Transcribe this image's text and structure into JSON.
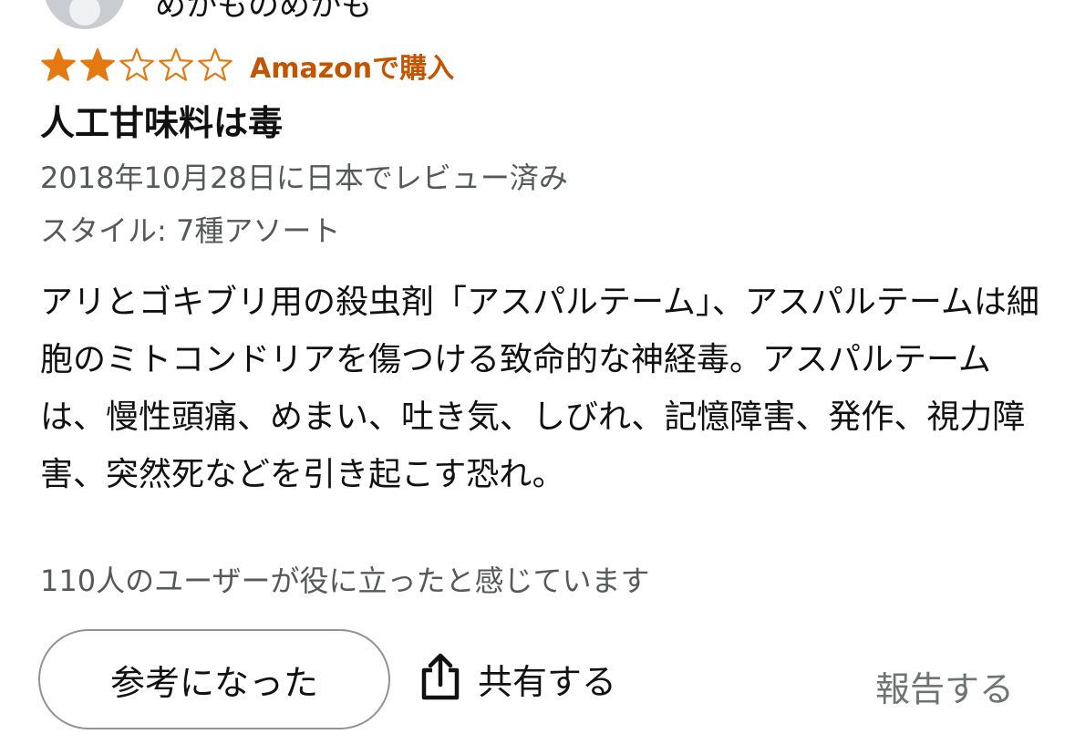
{
  "review": {
    "reviewer_name": "めかものめかも",
    "rating": 2,
    "rating_max": 5,
    "star_color": "#e47911",
    "verified_label": "Amazonで購入",
    "title": "人工甘味料は毒",
    "date_line": "2018年10月28日に日本でレビュー済み",
    "style_line": "スタイル: 7種アソート",
    "body": "アリとゴキブリ用の殺虫剤「アスパルテーム」、アスパルテームは細胞のミトコンドリアを傷つける致命的な神経毒。アスパルテームは、慢性頭痛、めまい、吐き気、しびれ、記憶障害、発作、視力障害、突然死などを引き起こす恐れ。",
    "helpful_count_text": "110人のユーザーが役に立ったと感じています"
  },
  "actions": {
    "helpful_label": "参考になった",
    "share_label": "共有する",
    "share_icon": "share-icon",
    "report_label": "報告する"
  }
}
